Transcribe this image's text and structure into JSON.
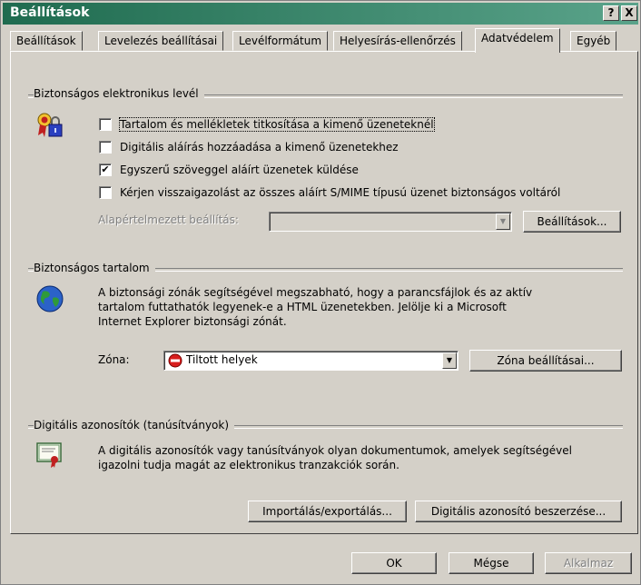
{
  "window": {
    "title": "Beállítások",
    "help_button": "?",
    "close_button": "X"
  },
  "tabs": [
    {
      "label": "Beállítások"
    },
    {
      "label": "Levelezés beállításai"
    },
    {
      "label": "Levélformátum"
    },
    {
      "label": "Helyesírás-ellenőrzés"
    },
    {
      "label": "Adatvédelem"
    },
    {
      "label": "Egyéb"
    }
  ],
  "secure_mail": {
    "label": "Biztonságos elektronikus levél",
    "checkboxes": [
      {
        "label": "Tartalom és mellékletek titkosítása a kimenő üzeneteknél",
        "checked": false
      },
      {
        "label": "Digitális aláírás hozzáadása a kimenő üzenetekhez",
        "checked": false
      },
      {
        "label": "Egyszerű szöveggel aláírt üzenetek küldése",
        "checked": true
      },
      {
        "label": "Kérjen visszaigazolást az összes aláírt S/MIME típusú üzenet biztonságos voltáról",
        "checked": false
      }
    ],
    "default_setting_label": "Alapértelmezett beállítás:",
    "default_setting_value": "",
    "settings_button": "Beállítások..."
  },
  "secure_content": {
    "label": "Biztonságos tartalom",
    "description_lines": [
      "A biztonsági zónák segítségével megszabható, hogy a parancsfájlok és az aktív",
      "tartalom futtathatók legyenek-e a HTML üzenetekben. Jelölje ki a Microsoft",
      "Internet Explorer biztonsági zónát."
    ],
    "zone_label": "Zóna:",
    "zone_value": "Tiltott helyek",
    "zone_settings_button": "Zóna beállításai..."
  },
  "digital_ids": {
    "label": "Digitális azonosítók (tanúsítványok)",
    "description_lines": [
      "A digitális azonosítók vagy tanúsítványok olyan dokumentumok, amelyek segítségével",
      "igazolni tudja magát az elektronikus tranzakciók során."
    ],
    "import_export_button": "Importálás/exportálás...",
    "get_id_button": "Digitális azonosító beszerzése..."
  },
  "footer": {
    "ok": "OK",
    "cancel": "Mégse",
    "apply": "Alkalmaz"
  }
}
